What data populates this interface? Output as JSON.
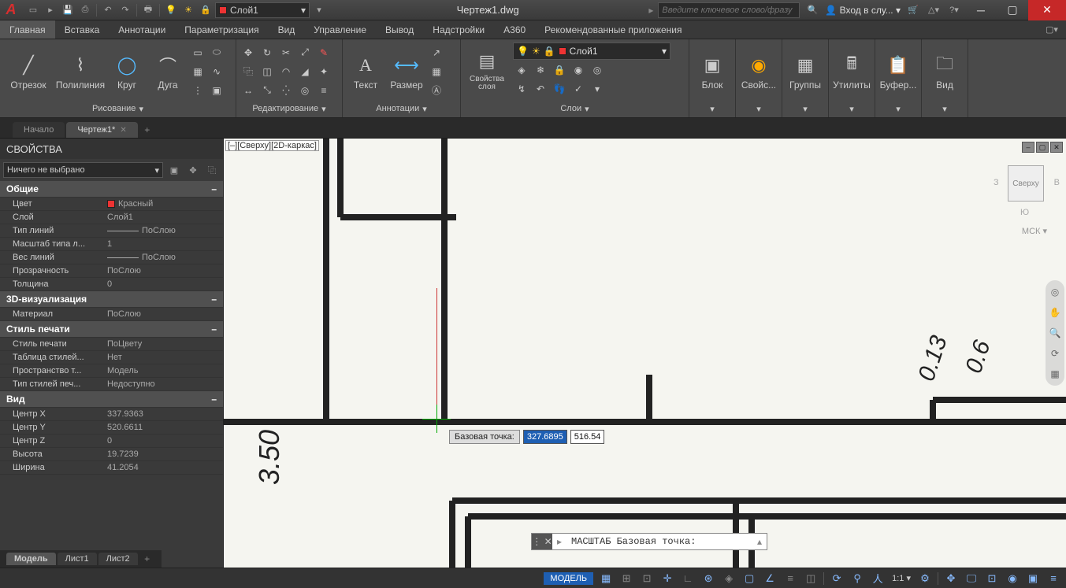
{
  "title": "Чертеж1.dwg",
  "search_placeholder": "Введите ключевое слово/фразу",
  "signin": "Вход в слу...",
  "menu": [
    "Главная",
    "Вставка",
    "Аннотации",
    "Параметризация",
    "Вид",
    "Управление",
    "Вывод",
    "Надстройки",
    "A360",
    "Рекомендованные приложения"
  ],
  "ribbon": {
    "draw": {
      "title": "Рисование",
      "items": [
        "Отрезок",
        "Полилиния",
        "Круг",
        "Дуга"
      ]
    },
    "modify": {
      "title": "Редактирование"
    },
    "annot": {
      "title": "Аннотации",
      "text": "Текст",
      "dim": "Размер"
    },
    "layers": {
      "title": "Слои",
      "props": "Свойства слоя",
      "current": "Слой1"
    },
    "block": {
      "title": "Блок",
      "label": "Блок"
    },
    "propsp": {
      "label": "Свойс..."
    },
    "groups": {
      "label": "Группы"
    },
    "utils": {
      "label": "Утилиты"
    },
    "clip": {
      "label": "Буфер..."
    },
    "view": {
      "label": "Вид"
    }
  },
  "qat_layer": "Слой1",
  "tabs": {
    "start": "Начало",
    "file": "Чертеж1*"
  },
  "props": {
    "title": "СВОЙСТВА",
    "noneSelected": "Ничего не выбрано",
    "groups": {
      "general": "Общие",
      "viz": "3D-визуализация",
      "plot": "Стиль печати",
      "view": "Вид"
    },
    "general": {
      "color_k": "Цвет",
      "color_v": "Красный",
      "layer_k": "Слой",
      "layer_v": "Слой1",
      "ltype_k": "Тип линий",
      "ltype_v": "ПоСлою",
      "ltscale_k": "Масштаб типа л...",
      "ltscale_v": "1",
      "lweight_k": "Вес линий",
      "lweight_v": "ПоСлою",
      "transp_k": "Прозрачность",
      "transp_v": "ПоСлою",
      "thick_k": "Толщина",
      "thick_v": "0"
    },
    "viz": {
      "mat_k": "Материал",
      "mat_v": "ПоСлою"
    },
    "plot": {
      "ps_k": "Стиль печати",
      "ps_v": "ПоЦвету",
      "pst_k": "Таблица стилей...",
      "pst_v": "Нет",
      "psp_k": "Пространство т...",
      "psp_v": "Модель",
      "pstype_k": "Тип стилей печ...",
      "pstype_v": "Недоступно"
    },
    "view": {
      "cx_k": "Центр X",
      "cx_v": "337.9363",
      "cy_k": "Центр Y",
      "cy_v": "520.6611",
      "cz_k": "Центр Z",
      "cz_v": "0",
      "h_k": "Высота",
      "h_v": "19.7239",
      "w_k": "Ширина",
      "w_v": "41.2054"
    }
  },
  "viewport_label": "[–][Сверху][2D-каркас]",
  "viewcube": "Сверху",
  "viewcube_dirs": {
    "w": "З",
    "e": "В",
    "s": "Ю"
  },
  "ucs": "МСК",
  "dyn": {
    "label": "Базовая точка:",
    "x": "327.6895",
    "y": "516.54"
  },
  "cmd": "МАСШТАБ Базовая точка:",
  "drawing_text": {
    "left": "3.50",
    "r1": "0.13",
    "r2": "0.6"
  },
  "modeltabs": [
    "Модель",
    "Лист1",
    "Лист2"
  ],
  "status": {
    "model": "МОДЕЛЬ",
    "scale": "1:1"
  }
}
